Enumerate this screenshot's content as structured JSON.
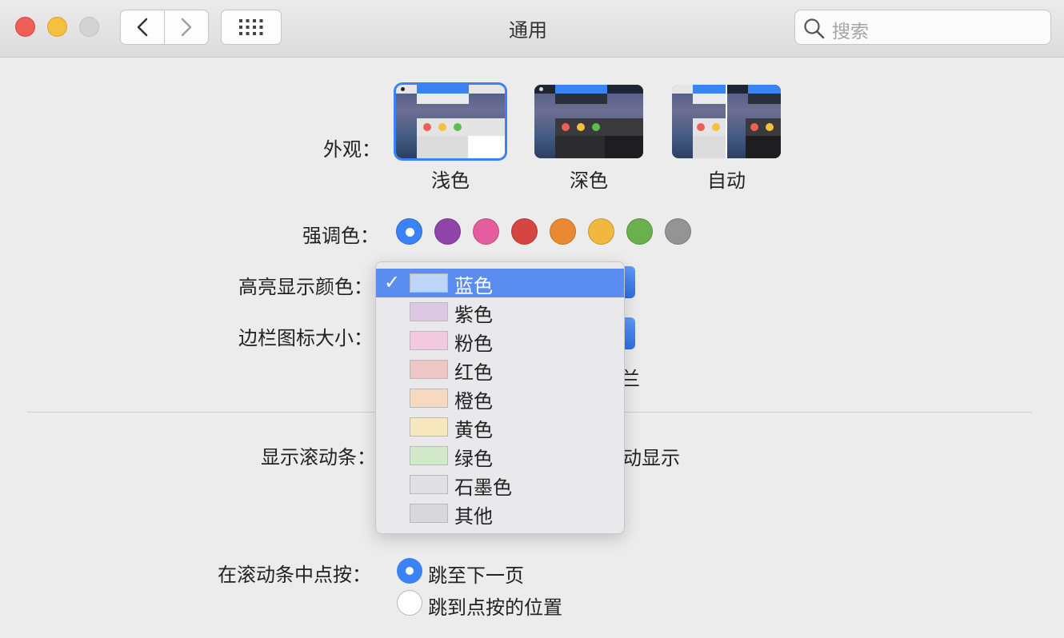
{
  "window": {
    "title": "通用"
  },
  "search": {
    "placeholder": "搜索"
  },
  "appearance": {
    "label": "外观：",
    "options": [
      "浅色",
      "深色",
      "自动"
    ],
    "selected": "浅色"
  },
  "accent": {
    "label": "强调色：",
    "colors": [
      "#3b82f6",
      "#8e44a8",
      "#e35d9f",
      "#d64541",
      "#e98a33",
      "#f2b73f",
      "#6ab04c",
      "#949494"
    ],
    "selected": 0
  },
  "highlight": {
    "label": "高亮显示颜色："
  },
  "sidebar_icon": {
    "label": "边栏图标大小：",
    "partial_text": "兰"
  },
  "scrollbars": {
    "label": "显示滚动条：",
    "partial_text": "动显示"
  },
  "menu": {
    "items": [
      {
        "label": "蓝色",
        "color": "#bcd6fb",
        "checked": true
      },
      {
        "label": "紫色",
        "color": "#dcc8e3"
      },
      {
        "label": "粉色",
        "color": "#f3c9e0"
      },
      {
        "label": "红色",
        "color": "#efc6c6"
      },
      {
        "label": "橙色",
        "color": "#f6d9c0"
      },
      {
        "label": "黄色",
        "color": "#f8e8c0"
      },
      {
        "label": "绿色",
        "color": "#d2e9c9"
      },
      {
        "label": "石墨色",
        "color": "#e0e0e2"
      },
      {
        "label": "其他",
        "color": "#d8d8da"
      }
    ],
    "check_mark": "✓"
  },
  "scroll_click": {
    "label": "在滚动条中点按：",
    "options": [
      "跳至下一页",
      "跳到点按的位置"
    ],
    "selected": 0
  }
}
